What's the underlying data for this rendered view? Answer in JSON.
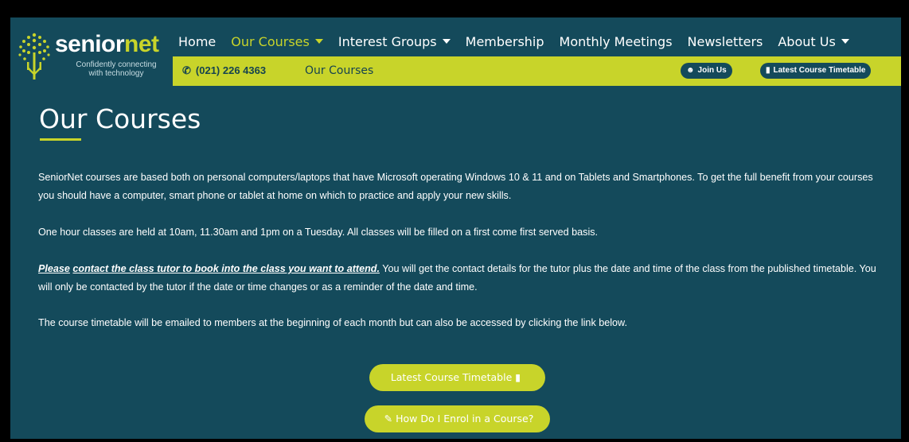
{
  "brand": {
    "word_part1": "senior",
    "word_part2": "net",
    "tagline_line1": "Confidently connecting",
    "tagline_line2": "with technology",
    "colors": {
      "background": "#144a5b",
      "accent": "#c8d42a",
      "text": "#ffffff"
    }
  },
  "nav": {
    "items": [
      {
        "label": "Home",
        "dropdown": false,
        "active": false
      },
      {
        "label": "Our Courses",
        "dropdown": true,
        "active": true
      },
      {
        "label": "Interest Groups",
        "dropdown": true,
        "active": false
      },
      {
        "label": "Membership",
        "dropdown": false,
        "active": false
      },
      {
        "label": "Monthly Meetings",
        "dropdown": false,
        "active": false
      },
      {
        "label": "Newsletters",
        "dropdown": false,
        "active": false
      },
      {
        "label": "About Us",
        "dropdown": true,
        "active": false
      }
    ]
  },
  "subbar": {
    "phone_icon": "phone-icon",
    "phone": "(021) 226 4363",
    "breadcrumb": "Our Courses",
    "join_icon": "users-icon",
    "join_label": "Join Us",
    "timetable_icon": "book-icon",
    "timetable_label": "Latest Course Timetable"
  },
  "main": {
    "title": "Our Courses",
    "paragraph1": "SeniorNet courses are based both on personal computers/laptops that have Microsoft operating Windows 10 & 11 and on Tablets and Smartphones.  To get the full benefit from your courses you should have a computer, smart phone or tablet at home on which to practice and apply your new skills.",
    "paragraph2": "One hour classes are held at 10am, 11.30am and 1pm on a Tuesday.  All classes will be filled on a first come first served basis.",
    "paragraph3_emphasis_part1": "Please",
    "paragraph3_emphasis_part2": "contact the class tutor to book into the class you want to attend.",
    "paragraph3_rest": "You will get the contact details for the tutor plus the date and time of the class from the published timetable. You will only be contacted by the tutor if the date or time changes or as a reminder of the date and time.",
    "paragraph4": "The course timetable will be emailed to members at the beginning of each month but can also be accessed by clicking the link below.",
    "timetable_button": "Latest Course Timetable",
    "timetable_button_icon": "book-icon",
    "enrol_button": "How Do I Enrol in a Course?",
    "enrol_button_icon": "pencil-icon"
  }
}
